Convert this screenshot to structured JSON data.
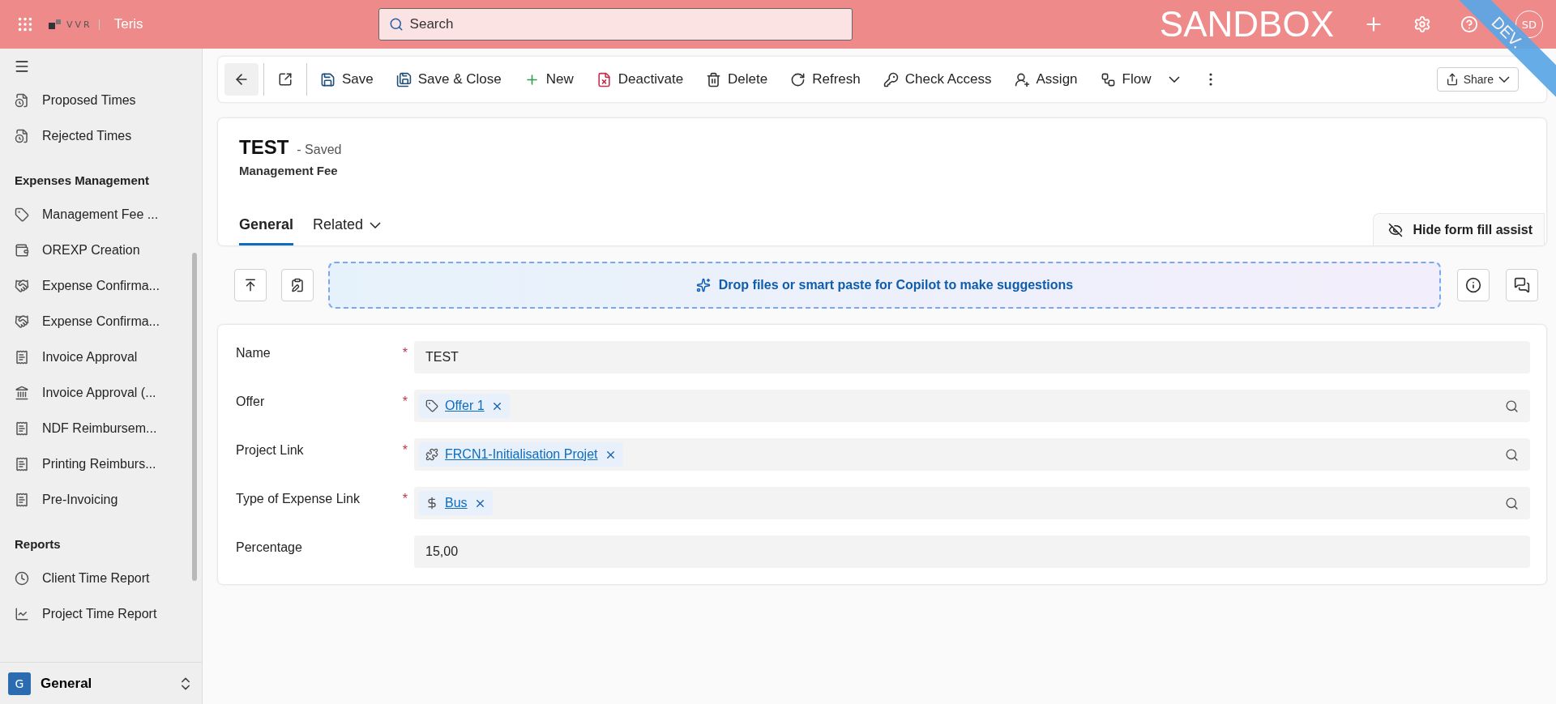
{
  "top_bar": {
    "app_name": "Teris",
    "logo_text": "VVR",
    "search": {
      "placeholder": "Search"
    },
    "environment": "SANDBOX",
    "avatar": "SD",
    "ribbon": "DEV."
  },
  "sidebar": {
    "sections": [
      {
        "items": [
          {
            "label": "Proposed Times",
            "kind": "clock-file"
          },
          {
            "label": "Rejected Times",
            "kind": "clock-file"
          }
        ]
      },
      {
        "title": "Expenses Management",
        "items": [
          {
            "label": "Management Fee ...",
            "kind": "tag"
          },
          {
            "label": "OREXP Creation",
            "kind": "wallet"
          },
          {
            "label": "Expense Confirma...",
            "kind": "handshake"
          },
          {
            "label": "Expense Confirma...",
            "kind": "handshake"
          },
          {
            "label": "Invoice Approval",
            "kind": "receipt"
          },
          {
            "label": "Invoice Approval (...",
            "kind": "bank"
          },
          {
            "label": "NDF Reimbursem...",
            "kind": "receipt"
          },
          {
            "label": "Printing Reimburs...",
            "kind": "receipt"
          },
          {
            "label": "Pre-Invoicing",
            "kind": "receipt"
          }
        ]
      },
      {
        "title": "Reports",
        "items": [
          {
            "label": "Client Time Report",
            "kind": "clock"
          },
          {
            "label": "Project Time Report",
            "kind": "chart"
          }
        ]
      }
    ],
    "area": {
      "badge": "G",
      "label": "General"
    }
  },
  "command_bar": {
    "commands": [
      {
        "label": "Save",
        "kind": "save"
      },
      {
        "label": "Save & Close",
        "kind": "save-close"
      },
      {
        "label": "New",
        "kind": "new"
      },
      {
        "label": "Deactivate",
        "kind": "deactivate"
      },
      {
        "label": "Delete",
        "kind": "delete"
      },
      {
        "label": "Refresh",
        "kind": "refresh"
      },
      {
        "label": "Check Access",
        "kind": "key"
      },
      {
        "label": "Assign",
        "kind": "assign"
      },
      {
        "label": "Flow",
        "kind": "flow"
      }
    ],
    "share": "Share"
  },
  "header": {
    "title": "TEST",
    "status": "- Saved",
    "entity": "Management Fee",
    "tabs": [
      {
        "label": "General",
        "selected": true,
        "dropdown": false
      },
      {
        "label": "Related",
        "selected": false,
        "dropdown": true
      }
    ],
    "assist_toggle": "Hide form fill assist"
  },
  "copilot": {
    "prompt": "Drop files or smart paste for Copilot to make suggestions"
  },
  "form": {
    "fields": [
      {
        "label": "Name",
        "required_mark": "*",
        "kind": "text",
        "value": "TEST"
      },
      {
        "label": "Offer",
        "required_mark": "*",
        "kind": "offer",
        "value": "Offer 1"
      },
      {
        "label": "Project Link",
        "required_mark": "*",
        "kind": "project",
        "value": "FRCN1-Initialisation Projet"
      },
      {
        "label": "Type of Expense Link",
        "required_mark": "*",
        "kind": "currency",
        "value": "Bus"
      },
      {
        "label": "Percentage",
        "kind": "text",
        "value": "15,00"
      }
    ]
  }
}
